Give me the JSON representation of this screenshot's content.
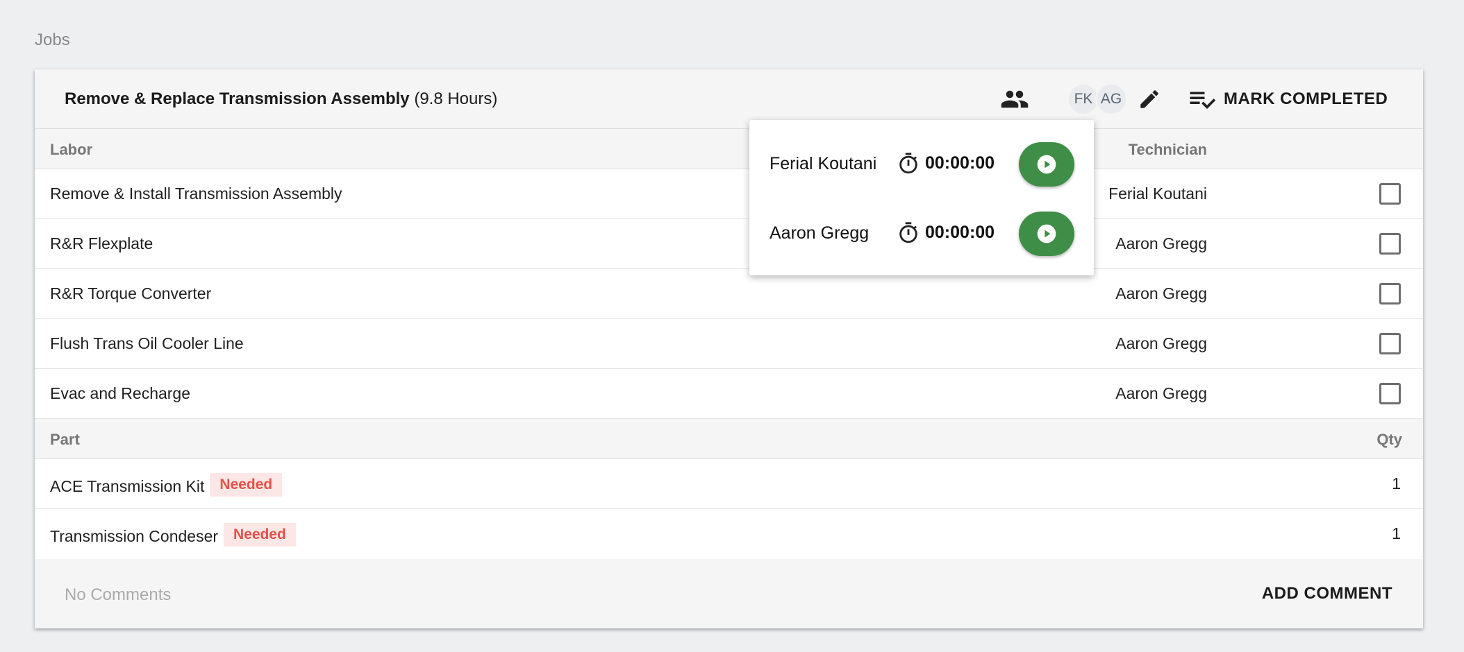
{
  "page": {
    "section_title": "Jobs"
  },
  "job": {
    "title": "Remove & Replace Transmission Assembly",
    "hours": "(9.8 Hours)",
    "assignees_icon": "people-icon",
    "avatars": [
      "FK",
      "AG"
    ],
    "edit_icon": "pencil-icon",
    "mark_completed_label": "MARK COMPLETED",
    "mark_completed_icon": "checklist-icon"
  },
  "labor": {
    "header": {
      "left": "Labor",
      "right": "Technician"
    },
    "rows": [
      {
        "name": "Remove & Install Transmission Assembly",
        "technician": "Ferial Koutani"
      },
      {
        "name": "R&R Flexplate",
        "technician": "Aaron Gregg"
      },
      {
        "name": "R&R Torque Converter",
        "technician": "Aaron Gregg"
      },
      {
        "name": "Flush Trans Oil Cooler Line",
        "technician": "Aaron Gregg"
      },
      {
        "name": "Evac and Recharge",
        "technician": "Aaron Gregg"
      }
    ]
  },
  "parts": {
    "header": {
      "left": "Part",
      "right": "Qty"
    },
    "rows": [
      {
        "name": "ACE Transmission Kit",
        "status": "Needed",
        "qty": "1"
      },
      {
        "name": "Transmission Condeser",
        "status": "Needed",
        "qty": "1"
      }
    ]
  },
  "footer": {
    "no_comments": "No Comments",
    "add_comment_label": "ADD COMMENT"
  },
  "timer_popover": {
    "rows": [
      {
        "name": "Ferial Koutani",
        "time": "00:00:00"
      },
      {
        "name": "Aaron Gregg",
        "time": "00:00:00"
      }
    ],
    "colors": {
      "play_button": "#3e8e47",
      "badge_text": "#e2514a",
      "badge_bg": "#fde7e6"
    }
  }
}
